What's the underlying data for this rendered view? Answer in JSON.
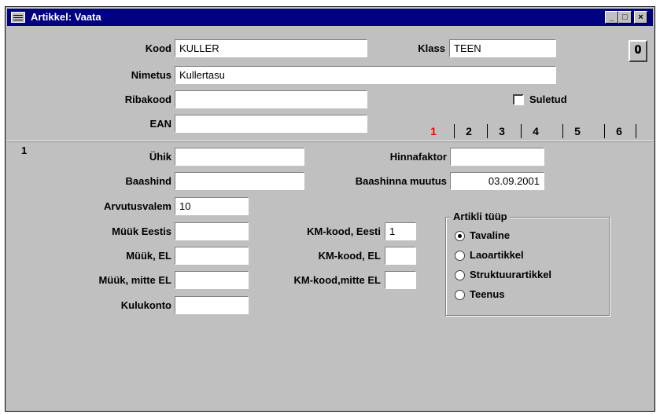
{
  "window": {
    "title": "Artikkel: Vaata",
    "minimize": "_",
    "maximize": "□",
    "close": "×"
  },
  "header": {
    "kood_label": "Kood",
    "kood_value": "KULLER",
    "klass_label": "Klass",
    "klass_value": "TEEN",
    "nimetus_label": "Nimetus",
    "nimetus_value": "Kullertasu",
    "ribakood_label": "Ribakood",
    "ribakood_value": "",
    "ean_label": "EAN",
    "ean_value": "",
    "suletud_label": "Suletud",
    "suletud_checked": false,
    "attach_icon": "paperclip-icon"
  },
  "tabs": [
    "1",
    "2",
    "3",
    "4",
    "5",
    "6"
  ],
  "active_tab": "1",
  "page_number": "1",
  "form": {
    "yhik_label": "Ühik",
    "yhik_value": "",
    "hinnafaktor_label": "Hinnafaktor",
    "hinnafaktor_value": "",
    "baashind_label": "Baashind",
    "baashind_value": "",
    "baashinna_muutus_label": "Baashinna muutus",
    "baashinna_muutus_value": "03.09.2001",
    "arvutusvalem_label": "Arvutusvalem",
    "arvutusvalem_value": "10",
    "myyk_eestis_label": "Müük Eestis",
    "myyk_eestis_value": "",
    "myyk_el_label": "Müük, EL",
    "myyk_el_value": "",
    "myyk_mitte_el_label": "Müük, mitte EL",
    "myyk_mitte_el_value": "",
    "kulukonto_label": "Kulukonto",
    "kulukonto_value": "",
    "km_kood_eesti_label": "KM-kood, Eesti",
    "km_kood_eesti_value": "1",
    "km_kood_el_label": "KM-kood, EL",
    "km_kood_el_value": "",
    "km_kood_mitte_el_label": "KM-kood,mitte EL",
    "km_kood_mitte_el_value": ""
  },
  "artikli_tyyp": {
    "title": "Artikli tüüp",
    "options": [
      "Tavaline",
      "Laoartikkel",
      "Struktuurartikkel",
      "Teenus"
    ],
    "selected": "Tavaline"
  }
}
